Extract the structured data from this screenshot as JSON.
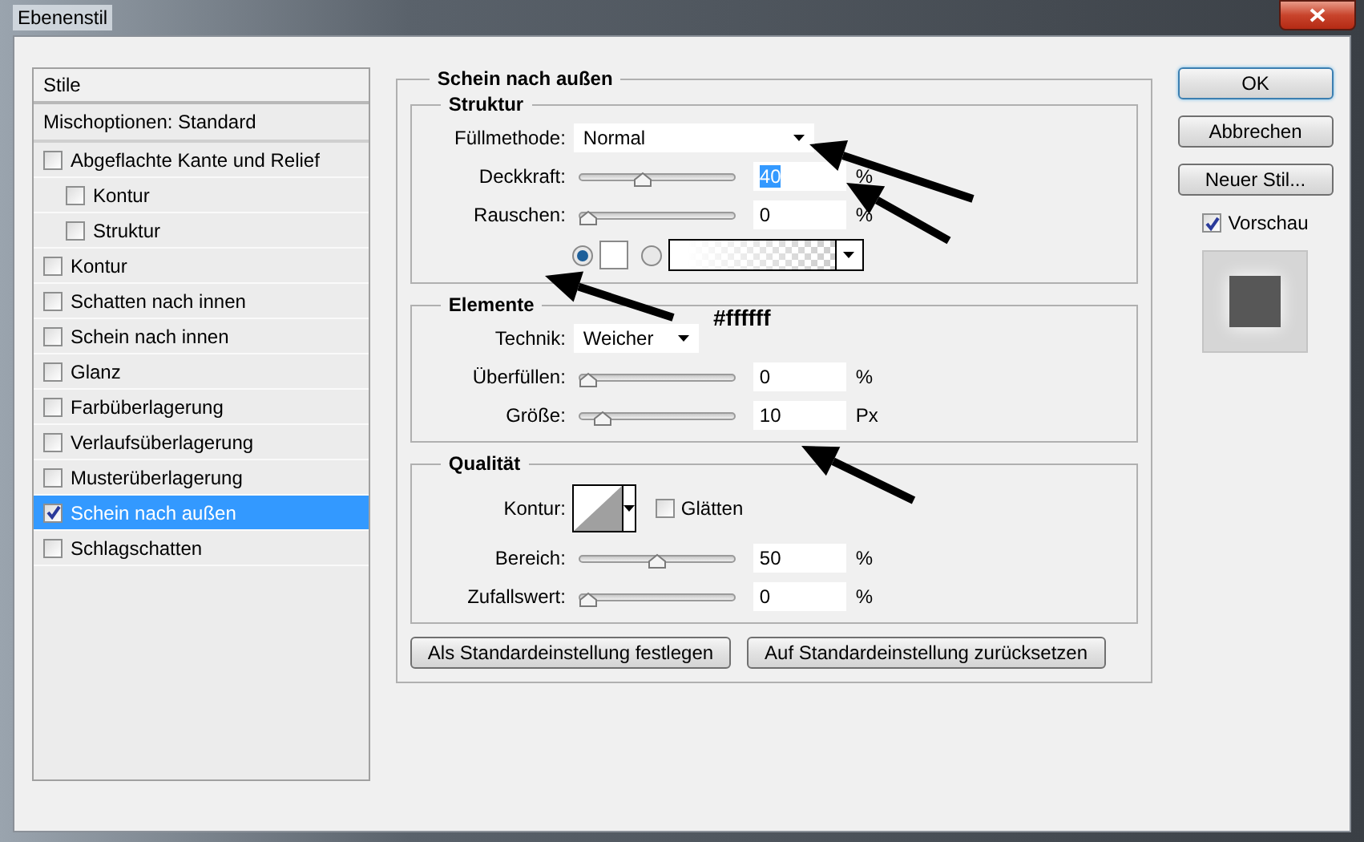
{
  "window": {
    "title": "Ebenenstil"
  },
  "styles_list": {
    "header": "Stile",
    "blend_options": "Mischoptionen: Standard",
    "items": [
      {
        "label": "Abgeflachte Kante und Relief",
        "checked": false,
        "selected": false,
        "children": [
          {
            "label": "Kontur",
            "checked": false,
            "selected": false
          },
          {
            "label": "Struktur",
            "checked": false,
            "selected": false
          }
        ]
      },
      {
        "label": "Kontur",
        "checked": false,
        "selected": false
      },
      {
        "label": "Schatten nach innen",
        "checked": false,
        "selected": false
      },
      {
        "label": "Schein nach innen",
        "checked": false,
        "selected": false
      },
      {
        "label": "Glanz",
        "checked": false,
        "selected": false
      },
      {
        "label": "Farbüberlagerung",
        "checked": false,
        "selected": false
      },
      {
        "label": "Verlaufsüberlagerung",
        "checked": false,
        "selected": false
      },
      {
        "label": "Musterüberlagerung",
        "checked": false,
        "selected": false
      },
      {
        "label": "Schein nach außen",
        "checked": true,
        "selected": true
      },
      {
        "label": "Schlagschatten",
        "checked": false,
        "selected": false
      }
    ]
  },
  "panel": {
    "title": "Schein nach außen",
    "groups": [
      {
        "title": "Struktur",
        "rows": [
          {
            "kind": "dropdown",
            "label": "Füllmethode:",
            "value": "Normal",
            "wide": true
          },
          {
            "kind": "slider",
            "label": "Deckkraft:",
            "level": 0.4,
            "value": "40",
            "unit": "%",
            "highlighted": true
          },
          {
            "kind": "slider",
            "label": "Rauschen:",
            "level": 0,
            "value": "0",
            "unit": "%"
          },
          {
            "kind": "color",
            "color_selected": true,
            "color": "#ffffff"
          }
        ]
      },
      {
        "title": "Elemente",
        "rows": [
          {
            "kind": "dropdown",
            "label": "Technik:",
            "value": "Weicher",
            "wide": false
          },
          {
            "kind": "slider",
            "label": "Überfüllen:",
            "level": 0,
            "value": "0",
            "unit": "%"
          },
          {
            "kind": "slider",
            "label": "Größe:",
            "level": 0.1,
            "value": "10",
            "unit": "Px"
          }
        ]
      },
      {
        "title": "Qualität",
        "rows": [
          {
            "kind": "contour",
            "label": "Kontur:",
            "smooth_label": "Glätten",
            "smooth": false
          },
          {
            "kind": "slider",
            "label": "Bereich:",
            "level": 0.5,
            "value": "50",
            "unit": "%"
          },
          {
            "kind": "slider",
            "label": "Zufallswert:",
            "level": 0,
            "value": "0",
            "unit": "%"
          }
        ]
      }
    ],
    "buttons": [
      "Als Standardeinstellung festlegen",
      "Auf Standardeinstellung zurücksetzen"
    ]
  },
  "actions": {
    "buttons": [
      {
        "label": "OK",
        "default": true
      },
      {
        "label": "Abbrechen",
        "default": false
      },
      {
        "label": "Neuer Stil...",
        "default": false
      }
    ],
    "preview": {
      "label": "Vorschau",
      "checked": true
    }
  },
  "annotation": "#ffffff"
}
